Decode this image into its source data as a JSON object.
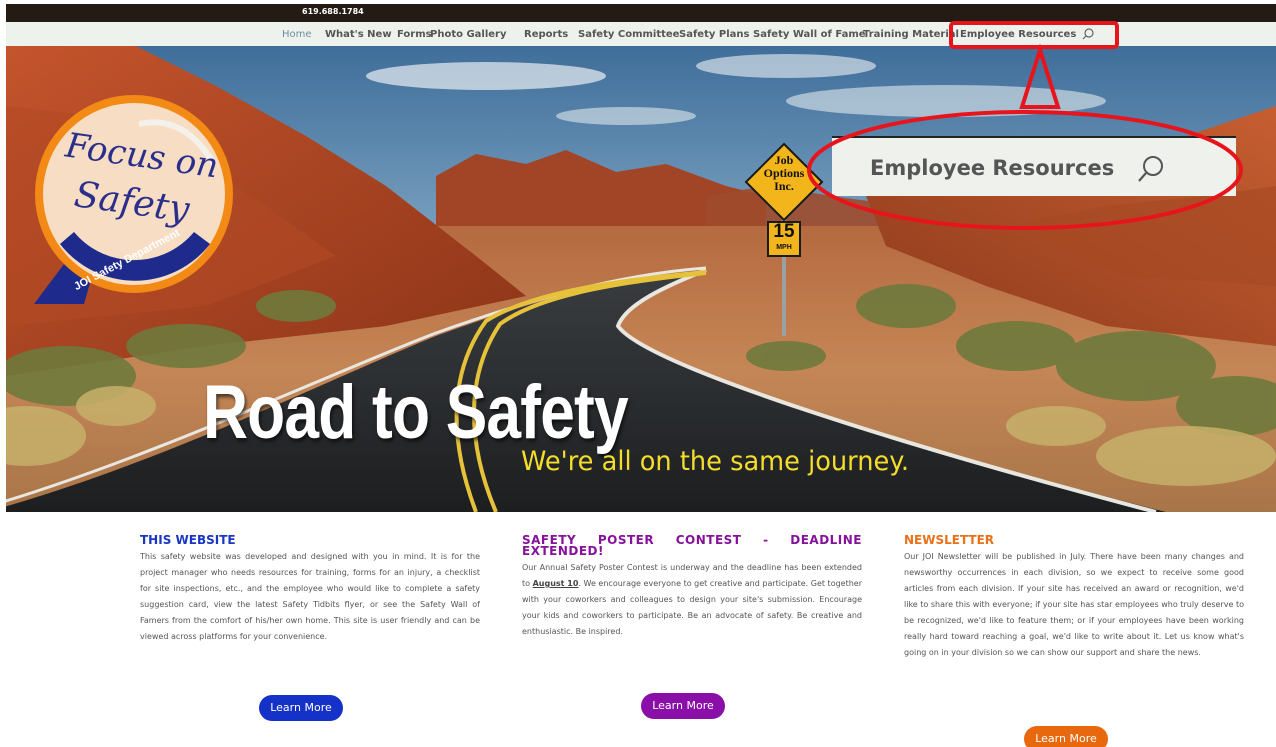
{
  "topbar": {
    "phone": "619.688.1784"
  },
  "nav": {
    "items": [
      {
        "label": "Home"
      },
      {
        "label": "What's New"
      },
      {
        "label": "Forms"
      },
      {
        "label": "Photo Gallery"
      },
      {
        "label": "Reports"
      },
      {
        "label": "Safety Committee"
      },
      {
        "label": "Safety Plans"
      },
      {
        "label": "Safety Wall of Fame"
      },
      {
        "label": "Training Material"
      },
      {
        "label": "Employee Resources"
      }
    ],
    "search_icon": "search-icon"
  },
  "hero": {
    "title": "Road to Safety",
    "subtitle": "We're all on the same journey.",
    "logo": {
      "line1": "Focus on",
      "line2": "Safety",
      "dept": "JOI Safety Department"
    },
    "sign": {
      "line1": "Job",
      "line2": "Options",
      "line3": "Inc.",
      "speed": "15",
      "unit": "MPH"
    },
    "zoom_callout": {
      "label": "Employee Resources"
    }
  },
  "columns": [
    {
      "heading": "THIS WEBSITE",
      "heading_color": "#1a36c4",
      "body": "This safety website was developed and designed with you in mind. It is for the project manager who needs resources for training, forms for an injury, a checklist for site inspections, etc., and the employee who would like to complete a safety suggestion card, view the latest Safety Tidbits flyer, or see the Safety Wall of Famers from the comfort of his/her own home. This site is user friendly and can be viewed across platforms for your convenience.",
      "button": "Learn More",
      "button_color": "#1432c8"
    },
    {
      "heading": "SAFETY POSTER CONTEST - DEADLINE EXTENDED!",
      "heading_color": "#86129c",
      "body_before": "Our Annual Safety Poster Contest is underway and the deadline has been extended to ",
      "body_bold": "August 10",
      "body_after": ". We encourage everyone to get creative and participate. Get together with your coworkers and colleagues to design your site's submission. Encourage your kids and coworkers to participate. Be an advocate of safety. Be creative and enthusiastic. Be inspired.",
      "button": "Learn More",
      "button_color": "#8a0fa8"
    },
    {
      "heading": "NEWSLETTER",
      "heading_color": "#e8711a",
      "body": "Our JOI Newsletter will be published in July. There have been many changes and newsworthy occurrences in each division, so we expect to receive some good articles from each division. If your site has received an award or recognition, we'd like to share this with everyone; if your site has star employees who truly deserve to be recognized, we'd like to feature them; or if your employees have been working really hard toward reaching a goal, we'd like to write about it. Let us know what's going on in your division so we can show our support and share the news.",
      "button": "Learn More",
      "button_color": "#e8680e"
    }
  ],
  "colors": {
    "annotation": "#e8141b",
    "nav_bg": "#eef2ed",
    "topbar_bg": "#231b14",
    "subtitle": "#f5dd2b"
  }
}
